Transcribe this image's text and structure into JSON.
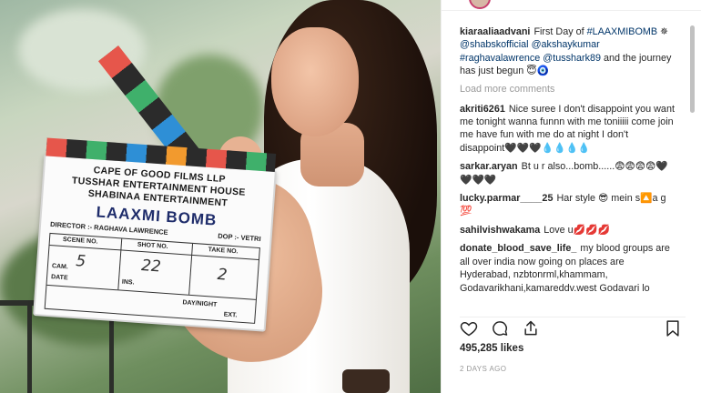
{
  "photo": {
    "clapper": {
      "line1": "CAPE OF GOOD FILMS LLP",
      "line2": "TUSSHAR ENTERTAINMENT HOUSE",
      "line3": "SHABINAA ENTERTAINMENT",
      "title": "LAAXMI BOMB",
      "director": "DIRECTOR :- RAGHAVA LAWRENCE",
      "dop": "DOP :- VETRI",
      "scene_label": "SCENE NO.",
      "shot_label": "SHOT NO.",
      "take_label": "TAKE NO.",
      "scene_value": "5",
      "shot_value": "22",
      "take_value": "2",
      "cam_label": "CAM.",
      "date_label": "DATE",
      "ins_label": "INS.",
      "daynight_label": "DAY/NIGHT",
      "ext_label": "EXT."
    }
  },
  "post": {
    "caption": {
      "user": "kiaraaliaadvani",
      "text_before": "First Day of",
      "hashtag": "#LAAXMIBOMB",
      "line2_prefix": "✵",
      "mention1": "@shabskofficial",
      "mention2": "@akshaykumar",
      "mention3": "#raghavalawrence",
      "mention4": "@tusshark89",
      "text_after": "and the journey has just begun 😇🧿"
    },
    "load_more": "Load more comments",
    "comments": [
      {
        "user": "akriti6261",
        "text": "Nice suree I don't disappoint you want me tonight wanna funnn with me toniiiii come join me have fun with me do at night I don't disappoint🖤🖤🖤💧💧💧💧"
      },
      {
        "user": "sarkar.aryan",
        "text": "Bt u r also...bomb......😨😨😨😨🖤🖤🖤🖤"
      },
      {
        "user": "lucky.parmar____25",
        "text": "Har style 😎 mein s🔼a g 💯"
      },
      {
        "user": "sahilvishwakama",
        "text": "Love u💋💋💋"
      },
      {
        "user": "donate_blood_save_life_",
        "text": "my blood groups are all over india now going on places are Hyderabad, nzbtonrml,khammam, Godavarikhani,kamareddv.west Godavari lo"
      }
    ],
    "likes": "495,285 likes",
    "time": "2 DAYS AGO",
    "icons": {
      "like": "heart-icon",
      "comment": "comment-bubble-icon",
      "share": "share-icon",
      "save": "bookmark-icon"
    },
    "colors": {
      "text": "#262626",
      "link": "#003569",
      "muted": "#999999"
    }
  }
}
